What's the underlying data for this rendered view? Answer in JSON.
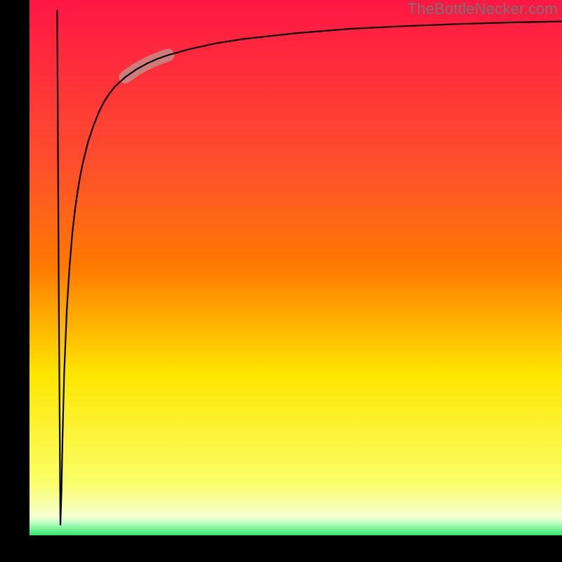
{
  "watermark": "TheBottleNecker.com",
  "chart_data": {
    "type": "line",
    "title": "",
    "xlabel": "",
    "ylabel": "",
    "xlim": [
      0,
      100
    ],
    "ylim": [
      0,
      100
    ],
    "background_gradient": {
      "top": "#FF1744",
      "mid_upper": "#FF7A00",
      "mid": "#FFE600",
      "mid_lower": "#FAFF66",
      "bottom": "#2CE86C"
    },
    "axis_color": "#000000",
    "axis_left_width": 42,
    "axis_bottom_height": 38,
    "series": [
      {
        "name": "curve",
        "color": "#000000",
        "stroke_width": 2.2,
        "x": [
          5.8,
          6.0,
          6.2,
          6.5,
          7.0,
          7.5,
          8.0,
          8.5,
          9.0,
          9.5,
          10,
          11,
          12,
          13,
          14,
          15,
          16,
          18,
          20,
          22,
          24,
          26,
          30,
          35,
          40,
          50,
          60,
          70,
          80,
          90,
          100
        ],
        "y": [
          2,
          8,
          18,
          30,
          42,
          50,
          56,
          60.5,
          64,
          67,
          69.5,
          73.5,
          76.5,
          79,
          81,
          82.5,
          83.8,
          85.6,
          87,
          88.1,
          89,
          89.7,
          90.8,
          91.9,
          92.7,
          93.8,
          94.6,
          95.1,
          95.5,
          95.8,
          96
        ]
      },
      {
        "name": "dip",
        "color": "#000000",
        "stroke_width": 2.2,
        "x": [
          5.2,
          5.5,
          5.8
        ],
        "y": [
          98,
          45,
          2
        ]
      }
    ],
    "highlight": {
      "color": "#C48B87",
      "opacity": 0.85,
      "stroke_width": 18,
      "x": [
        18,
        20,
        22,
        24,
        26
      ],
      "y": [
        85.6,
        87,
        88.1,
        89,
        89.7
      ]
    }
  }
}
